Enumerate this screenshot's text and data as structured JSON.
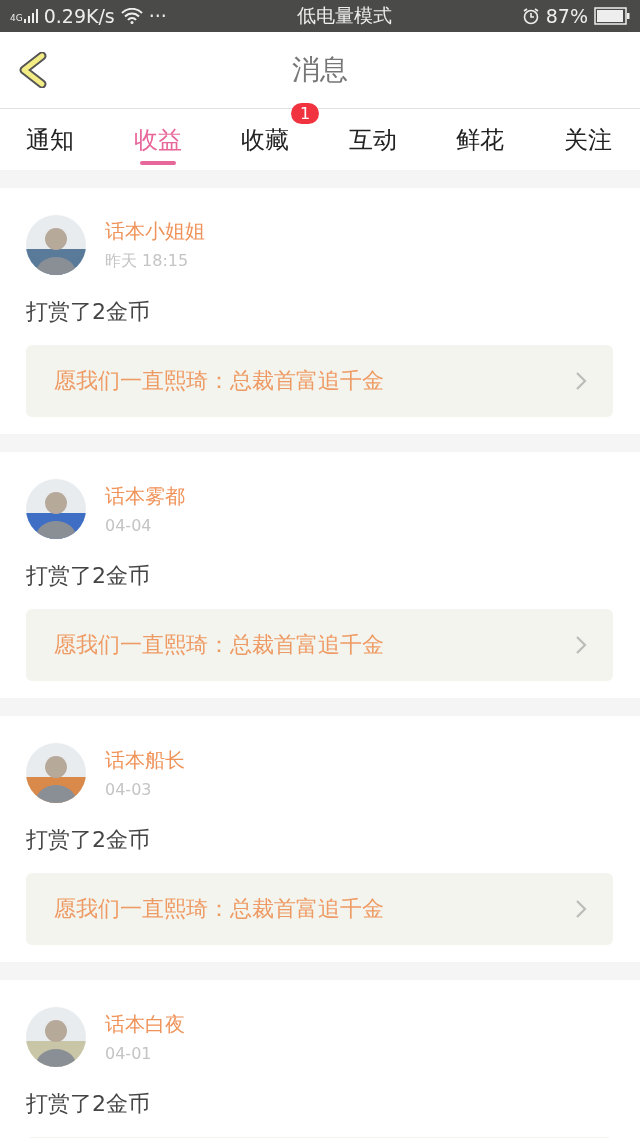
{
  "status_bar": {
    "network": "4G",
    "speed": "0.29K/s",
    "more": "···",
    "mode": "低电量模式",
    "battery": "87%"
  },
  "header": {
    "title": "消息"
  },
  "tabs": [
    {
      "label": "通知",
      "selected": false
    },
    {
      "label": "收益",
      "selected": true
    },
    {
      "label": "收藏",
      "selected": false,
      "badge": "1"
    },
    {
      "label": "互动",
      "selected": false
    },
    {
      "label": "鲜花",
      "selected": false
    },
    {
      "label": "关注",
      "selected": false
    }
  ],
  "messages": [
    {
      "name": "话本小姐姐",
      "time": "昨天 18:15",
      "text": "打赏了2金币",
      "book": "愿我们一直熙琦：总裁首富追千金"
    },
    {
      "name": "话本雾都",
      "time": "04-04",
      "text": "打赏了2金币",
      "book": "愿我们一直熙琦：总裁首富追千金"
    },
    {
      "name": "话本船长",
      "time": "04-03",
      "text": "打赏了2金币",
      "book": "愿我们一直熙琦：总裁首富追千金"
    },
    {
      "name": "话本白夜",
      "time": "04-01",
      "text": "打赏了2金币",
      "empty_box": true
    }
  ]
}
